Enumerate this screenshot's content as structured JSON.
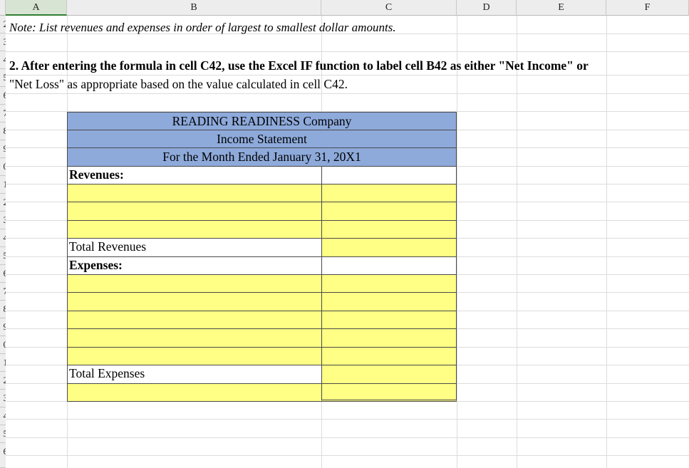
{
  "columns": [
    "A",
    "B",
    "C",
    "D",
    "E",
    "F"
  ],
  "selected_column": "A",
  "row_numbers": [
    "2",
    "3",
    "4",
    "5",
    "6",
    "7",
    "8",
    "9",
    "0",
    "1",
    "2",
    "3",
    "4",
    "5",
    "6",
    "7",
    "8",
    "9",
    "0",
    "1",
    "2",
    "3",
    "4",
    "5",
    "6"
  ],
  "note": "Note:  List revenues and expenses in order of largest to smallest dollar amounts.",
  "instruction": {
    "line1": "2. After entering the formula in cell C42, use the Excel IF function to label cell B42 as either \"Net Income\" or",
    "line2": "\"Net Loss\" as appropriate based on the value calculated in cell C42."
  },
  "statement": {
    "company": "READING READINESS Company",
    "title": "Income Statement",
    "period": "For the Month Ended January 31, 20X1",
    "revenues_label": "Revenues:",
    "total_revenues_label": "Total Revenues",
    "expenses_label": "Expenses:",
    "total_expenses_label": "Total Expenses"
  },
  "colors": {
    "header_blue": "#8eaadb",
    "input_yellow": "#ffff85",
    "selected_header": "#d8e4d3"
  }
}
